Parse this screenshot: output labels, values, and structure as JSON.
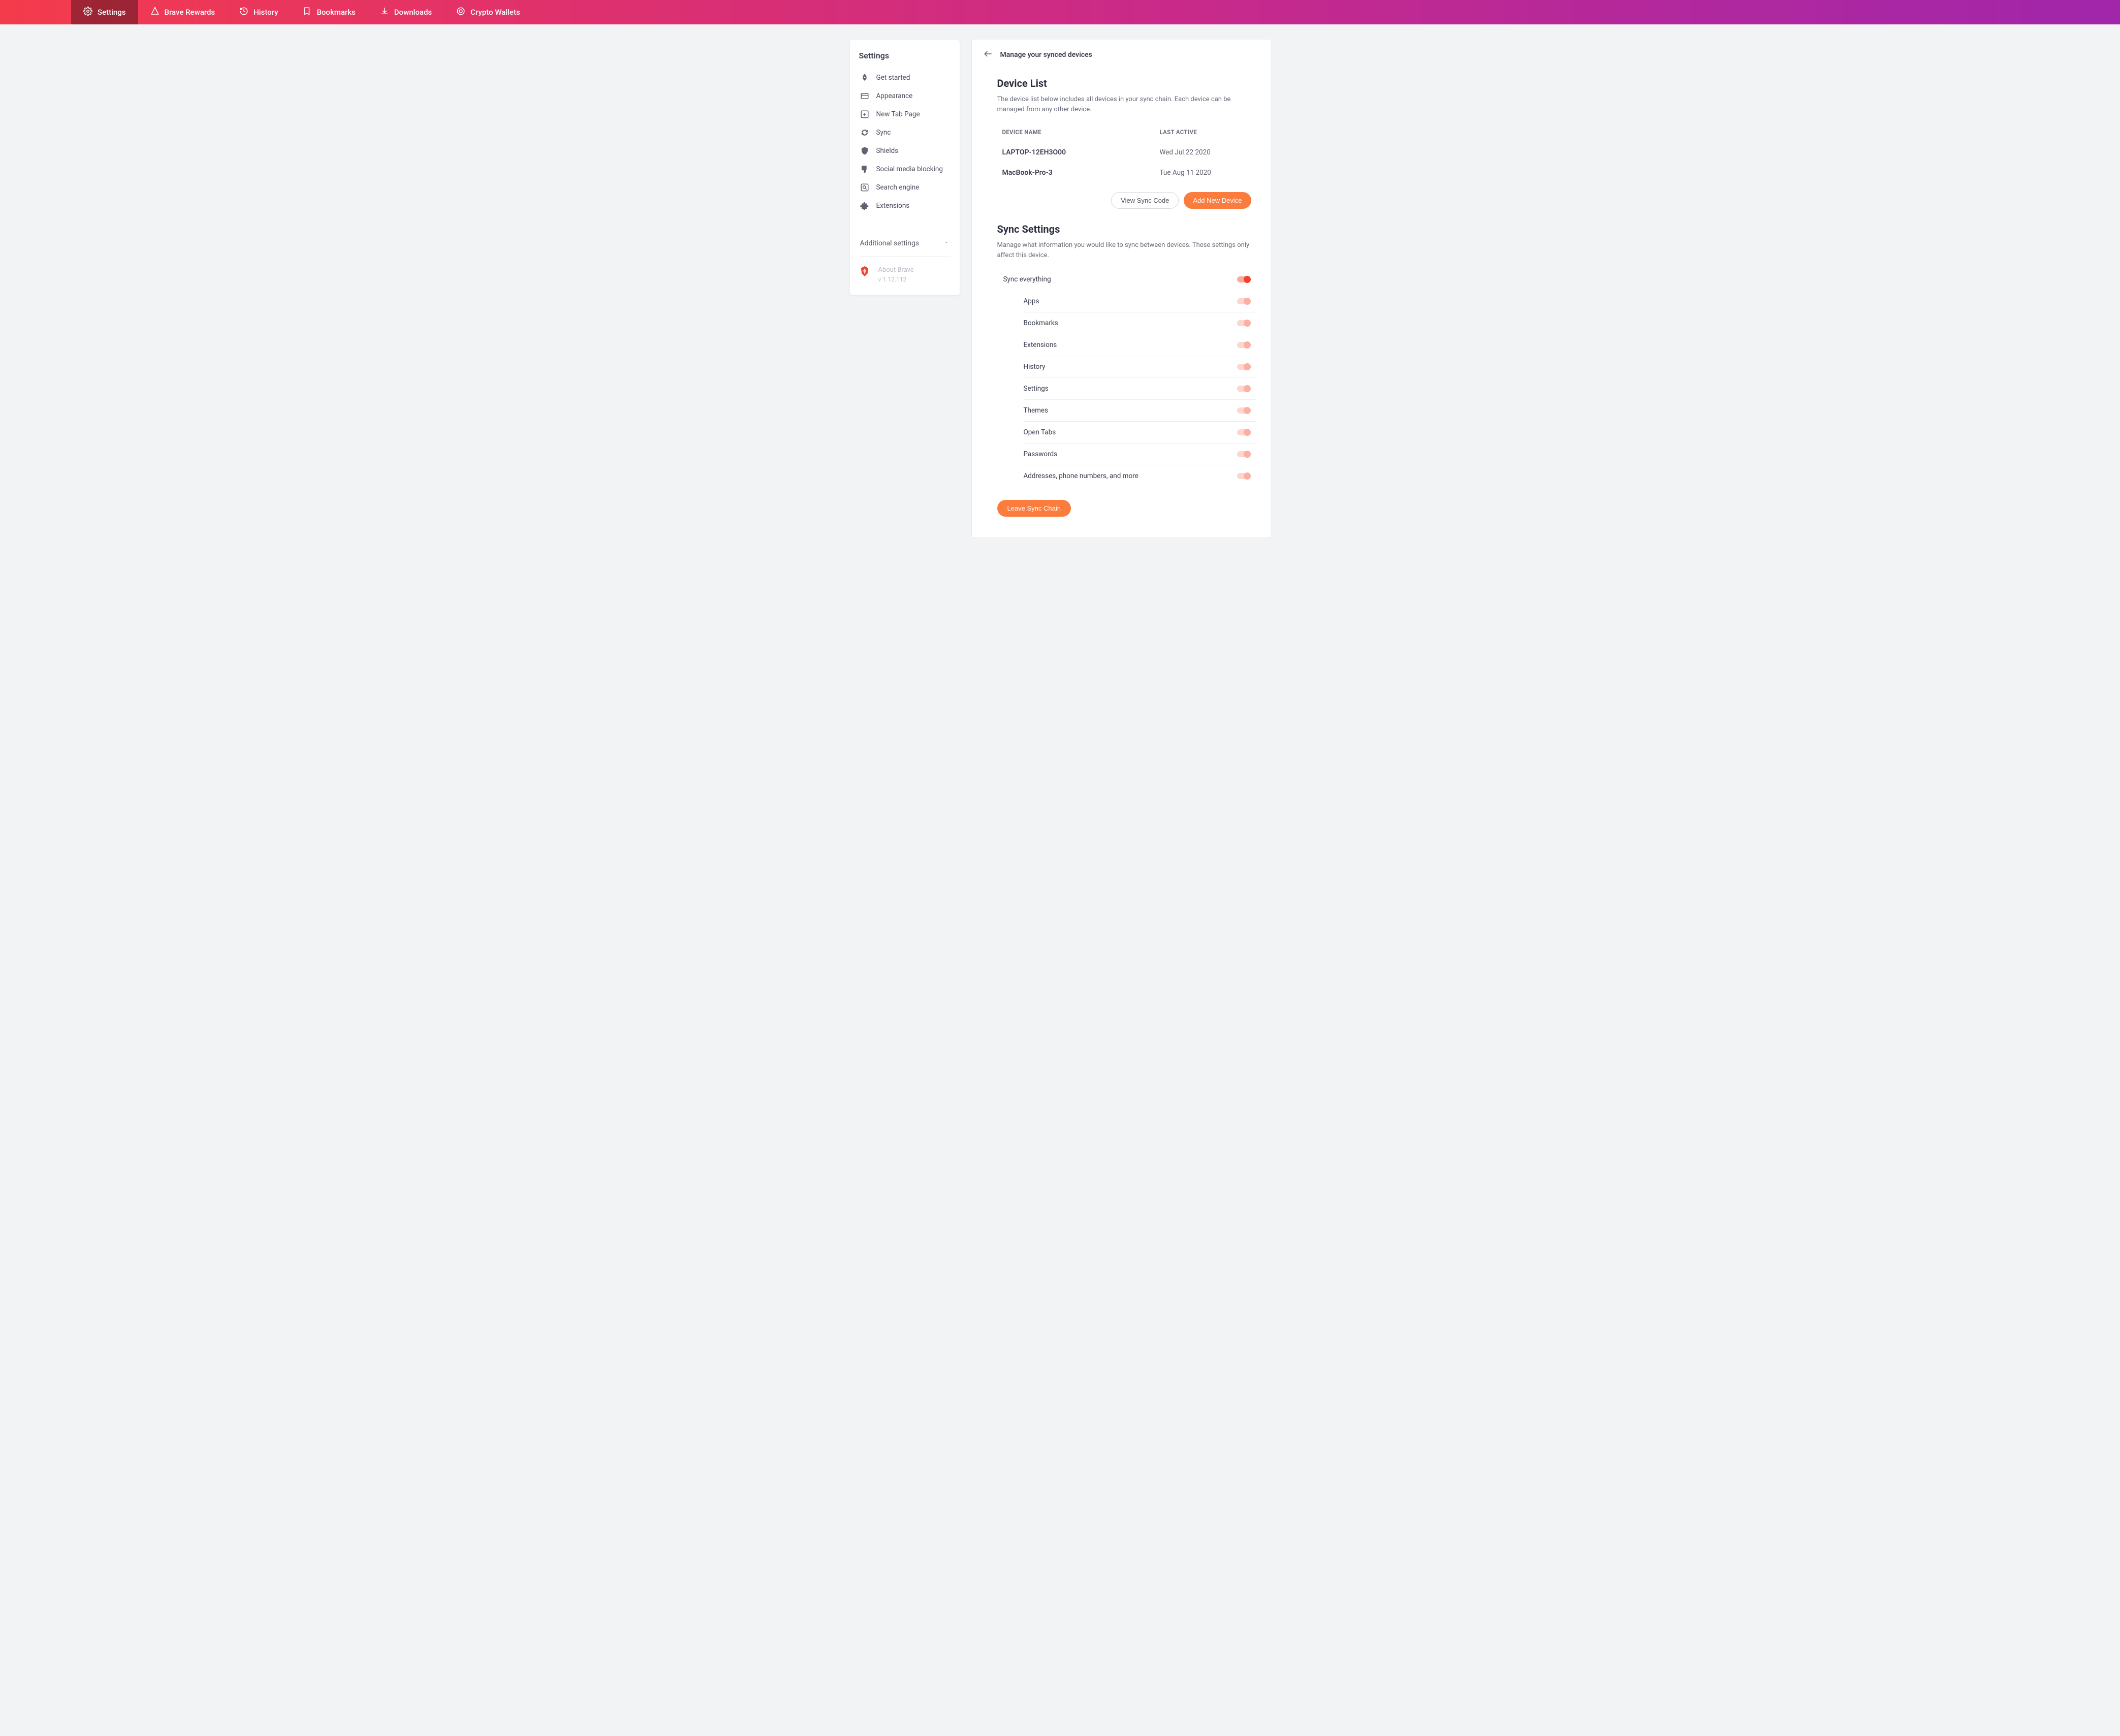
{
  "topbar": {
    "items": [
      {
        "label": "Settings"
      },
      {
        "label": "Brave Rewards"
      },
      {
        "label": "History"
      },
      {
        "label": "Bookmarks"
      },
      {
        "label": "Downloads"
      },
      {
        "label": "Crypto Wallets"
      }
    ]
  },
  "sidebar": {
    "title": "Settings",
    "items": [
      {
        "label": "Get started"
      },
      {
        "label": "Appearance"
      },
      {
        "label": "New Tab Page"
      },
      {
        "label": "Sync"
      },
      {
        "label": "Shields"
      },
      {
        "label": "Social media blocking"
      },
      {
        "label": "Search engine"
      },
      {
        "label": "Extensions"
      }
    ],
    "additional_label": "Additional settings",
    "about_title": "About Brave",
    "about_version": "v 1.12.112"
  },
  "main": {
    "header_title": "Manage your synced devices",
    "device_list": {
      "title": "Device List",
      "desc": "The device list below includes all devices in your sync chain. Each device can be managed from any other device.",
      "col_name": "DEVICE NAME",
      "col_active": "LAST ACTIVE",
      "rows": [
        {
          "name": "LAPTOP-12EH3O00",
          "active": "Wed Jul 22 2020"
        },
        {
          "name": "MacBook-Pro-3",
          "active": "Tue Aug 11 2020"
        }
      ],
      "view_code_btn": "View Sync Code",
      "add_device_btn": "Add New Device"
    },
    "sync_settings": {
      "title": "Sync Settings",
      "desc": "Manage what information you would like to sync between devices. These settings only affect this device.",
      "master_label": "Sync everything",
      "items": [
        {
          "label": "Apps"
        },
        {
          "label": "Bookmarks"
        },
        {
          "label": "Extensions"
        },
        {
          "label": "History"
        },
        {
          "label": "Settings"
        },
        {
          "label": "Themes"
        },
        {
          "label": "Open Tabs"
        },
        {
          "label": "Passwords"
        },
        {
          "label": "Addresses, phone numbers, and more"
        }
      ]
    },
    "leave_btn": "Leave Sync Chain"
  }
}
